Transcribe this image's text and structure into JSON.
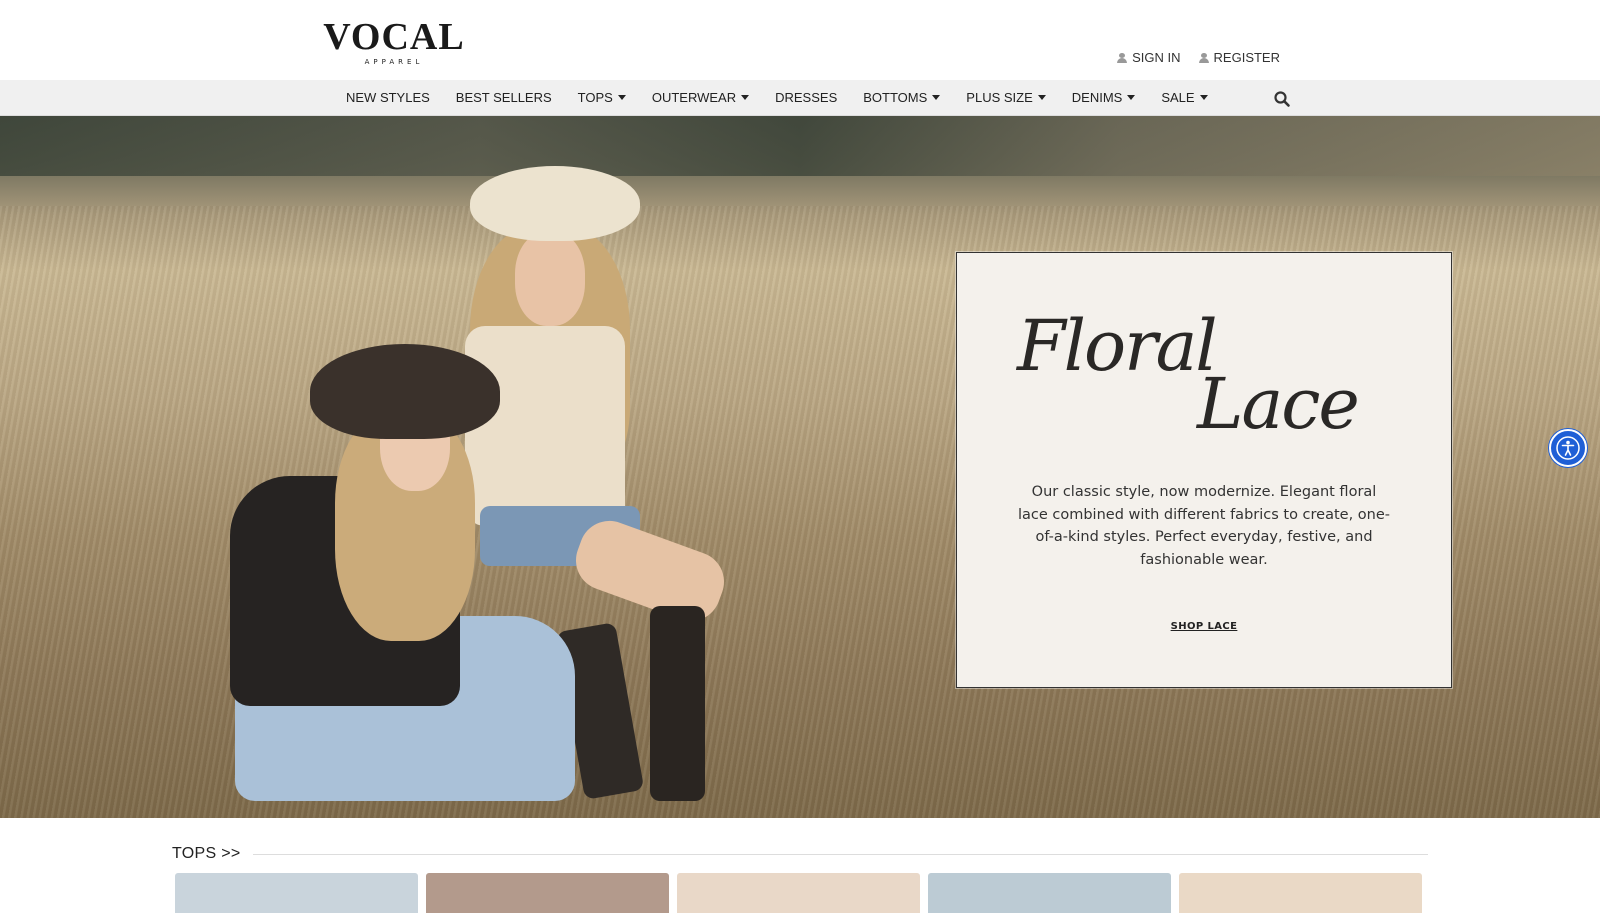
{
  "header": {
    "logo_main": "VOCAL",
    "logo_sub": "APPAREL",
    "sign_in": "SIGN IN",
    "register": "REGISTER"
  },
  "nav": {
    "items": [
      {
        "label": "NEW STYLES",
        "dropdown": false
      },
      {
        "label": "BEST SELLERS",
        "dropdown": false
      },
      {
        "label": "TOPS",
        "dropdown": true
      },
      {
        "label": "OUTERWEAR",
        "dropdown": true
      },
      {
        "label": "DRESSES",
        "dropdown": false
      },
      {
        "label": "BOTTOMS",
        "dropdown": true
      },
      {
        "label": "PLUS SIZE",
        "dropdown": true
      },
      {
        "label": "DENIMS",
        "dropdown": true
      },
      {
        "label": "SALE",
        "dropdown": true
      }
    ],
    "search_icon": "search-icon"
  },
  "hero": {
    "title_line1": "Floral",
    "title_line2": "Lace",
    "description": "Our classic style, now modernize. Elegant floral lace combined with different fabrics to create, one-of-a-kind styles. Perfect everyday, festive, and fashionable wear.",
    "cta": "SHOP LACE"
  },
  "accessibility": {
    "icon": "accessibility-icon"
  },
  "section": {
    "title": "TOPS >>",
    "thumbnails": [
      {
        "color": "#c9d4dc"
      },
      {
        "color": "#b39a8c"
      },
      {
        "color": "#e9d8c8"
      },
      {
        "color": "#bccbd4"
      },
      {
        "color": "#ead9c6"
      }
    ]
  },
  "colors": {
    "accent_blue": "#1f5fd6",
    "nav_bg": "#f0f0f0",
    "promo_bg": "#f4f1ec"
  }
}
